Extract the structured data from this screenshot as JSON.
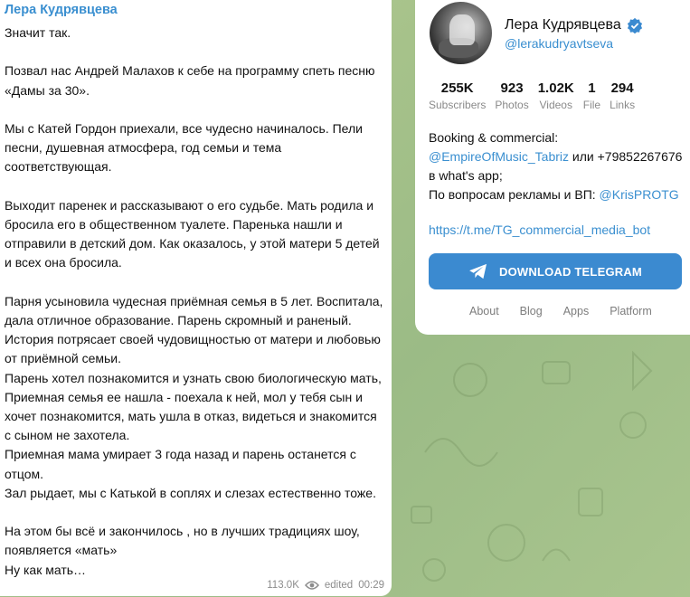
{
  "message": {
    "author": "Лера Кудрявцева",
    "paragraphs": [
      [
        "Значит так."
      ],
      [
        "Позвал нас Андрей Малахов к себе на программу спеть песню «Дамы за 30»."
      ],
      [
        "Мы с Катей Гордон приехали, все чудесно начиналось. Пели песни, душевная атмосфера, год семьи и тема соответствующая."
      ],
      [
        "Выходит паренек и рассказывают о его судьбе. Мать родила и бросила его в общественном туалете. Паренька нашли и отправили в детский дом. Как оказалось, у этой матери 5 детей и всех она бросила."
      ],
      [
        "Парня усыновила чудесная приёмная семья в 5 лет. Воспитала, дала отличное образование. Парень скромный и раненый.",
        "История потрясает своей чудовищностью от матери и любовью от приёмной семьи.",
        "Парень хотел познакомится и узнать свою биологическую мать, Приемная семья ее нашла - поехала к ней, мол у тебя сын и хочет познакомится, мать ушла в отказ, видеться и знакомится с сыном не захотела.",
        "Приемная мама умирает 3 года назад и парень останется с отцом.",
        "Зал рыдает, мы с Катькой в соплях и слезах естественно тоже."
      ],
      [
        "На этом бы всё и закончилось , но в лучших традициях шоу, появляется «мать»",
        "Ну как мать…"
      ]
    ],
    "views": "113.0K",
    "edited": "edited",
    "time": "00:29"
  },
  "channel": {
    "name": "Лера Кудрявцева",
    "handle": "@lerakudryavtseva",
    "stats": [
      {
        "num": "255K",
        "label": "Subscribers"
      },
      {
        "num": "923",
        "label": "Photos"
      },
      {
        "num": "1.02K",
        "label": "Videos"
      },
      {
        "num": "1",
        "label": "File"
      },
      {
        "num": "294",
        "label": "Links"
      }
    ],
    "desc": {
      "line1": "Booking & commercial:",
      "link1": "@EmpireOfMusic_Tabriz",
      "line2_rest": " или +79852267676",
      "line3": "в what's app;",
      "line4_pre": "По вопросам рекламы и ВП: ",
      "link2": "@KrisPROTG"
    },
    "url": "https://t.me/TG_commercial_media_bot",
    "download_label": "DOWNLOAD TELEGRAM",
    "footer": [
      "About",
      "Blog",
      "Apps",
      "Platform"
    ]
  },
  "colors": {
    "accent": "#3b8ad0",
    "link": "#3a8fd0",
    "background": "#a6c28a"
  }
}
